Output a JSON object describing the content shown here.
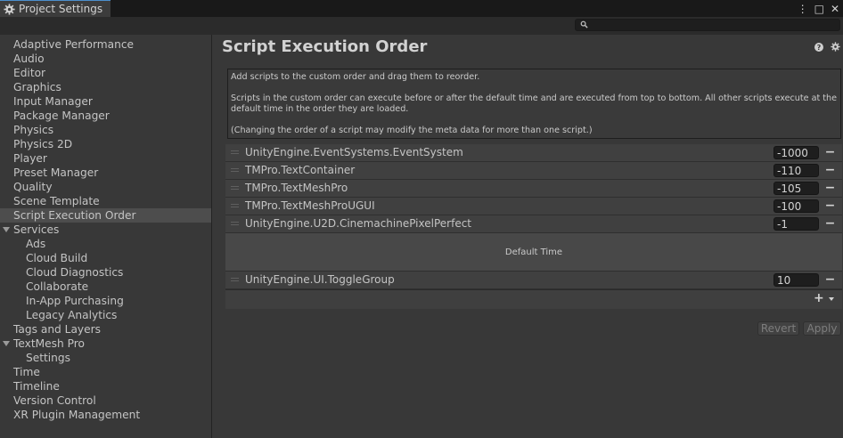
{
  "window": {
    "tab_title": "Project Settings",
    "controls": [
      "⋮",
      "□",
      "✕"
    ]
  },
  "search": {
    "placeholder": "",
    "value": ""
  },
  "sidebar": {
    "items": [
      {
        "label": "Adaptive Performance",
        "level": 0
      },
      {
        "label": "Audio",
        "level": 0
      },
      {
        "label": "Editor",
        "level": 0
      },
      {
        "label": "Graphics",
        "level": 0
      },
      {
        "label": "Input Manager",
        "level": 0
      },
      {
        "label": "Package Manager",
        "level": 0
      },
      {
        "label": "Physics",
        "level": 0
      },
      {
        "label": "Physics 2D",
        "level": 0
      },
      {
        "label": "Player",
        "level": 0
      },
      {
        "label": "Preset Manager",
        "level": 0
      },
      {
        "label": "Quality",
        "level": 0
      },
      {
        "label": "Scene Template",
        "level": 0
      },
      {
        "label": "Script Execution Order",
        "level": 0,
        "selected": true
      },
      {
        "label": "Services",
        "level": 0,
        "expanded": true
      },
      {
        "label": "Ads",
        "level": 1
      },
      {
        "label": "Cloud Build",
        "level": 1
      },
      {
        "label": "Cloud Diagnostics",
        "level": 1
      },
      {
        "label": "Collaborate",
        "level": 1
      },
      {
        "label": "In-App Purchasing",
        "level": 1
      },
      {
        "label": "Legacy Analytics",
        "level": 1
      },
      {
        "label": "Tags and Layers",
        "level": 0
      },
      {
        "label": "TextMesh Pro",
        "level": 0,
        "expanded": true
      },
      {
        "label": "Settings",
        "level": 1
      },
      {
        "label": "Time",
        "level": 0
      },
      {
        "label": "Timeline",
        "level": 0
      },
      {
        "label": "Version Control",
        "level": 0
      },
      {
        "label": "XR Plugin Management",
        "level": 0
      }
    ]
  },
  "main": {
    "title": "Script Execution Order",
    "help": {
      "line1": "Add scripts to the custom order and drag them to reorder.",
      "line2": "Scripts in the custom order can execute before or after the default time and are executed from top to bottom. All other scripts execute at the default time in the order they are loaded.",
      "line3": "(Changing the order of a script may modify the meta data for more than one script.)"
    },
    "scripts_before": [
      {
        "name": "UnityEngine.EventSystems.EventSystem",
        "order": "-1000"
      },
      {
        "name": "TMPro.TextContainer",
        "order": "-110"
      },
      {
        "name": "TMPro.TextMeshPro",
        "order": "-105"
      },
      {
        "name": "TMPro.TextMeshProUGUI",
        "order": "-100"
      },
      {
        "name": "UnityEngine.U2D.CinemachinePixelPerfect",
        "order": "-1"
      }
    ],
    "default_time_label": "Default Time",
    "scripts_after": [
      {
        "name": "UnityEngine.UI.ToggleGroup",
        "order": "10"
      }
    ],
    "remove_label": "−",
    "add_label": "+",
    "revert_label": "Revert",
    "apply_label": "Apply"
  }
}
